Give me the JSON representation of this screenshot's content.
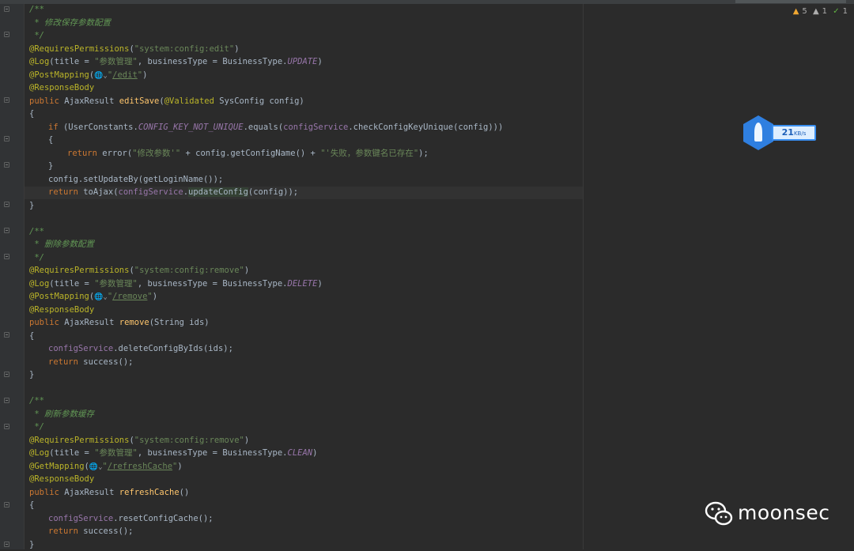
{
  "inspections": {
    "warnings": "5",
    "weak_warnings": "1",
    "ok": "1"
  },
  "net_widget": {
    "speed": "21",
    "unit": "KB/s"
  },
  "watermark": {
    "text": "moonsec"
  },
  "code": {
    "b1": {
      "doc_open": "/**",
      "doc_text": " * 修改保存参数配置",
      "doc_close": " */",
      "perm_ann": "@RequiresPermissions",
      "perm_val": "\"system:config:edit\"",
      "log_ann": "@Log",
      "log_args_a": "(title = ",
      "log_title": "\"参数管理\"",
      "log_args_b": ", businessType = BusinessType.",
      "log_type": "UPDATE",
      "map_ann": "@PostMapping",
      "map_path": "/edit",
      "resp_ann": "@ResponseBody",
      "sig_kw": "public",
      "sig_type": " AjaxResult ",
      "sig_name": "editSave",
      "sig_valid": "@Validated",
      "sig_params": " SysConfig config)",
      "brace_open": "{",
      "if_kw": "if",
      "if_a": " (UserConstants.",
      "if_const": "CONFIG_KEY_NOT_UNIQUE",
      "if_b": ".equals(",
      "if_field": "configService",
      "if_c": ".checkConfigKeyUnique(config)))",
      "inner_open": "{",
      "ret_kw": "return",
      "ret_a": " error(",
      "ret_s1": "\"修改参数'\"",
      "ret_b": " + config.getConfigName() + ",
      "ret_s2": "\"'失败，参数键名已存在\"",
      "ret_c": ");",
      "inner_close": "}",
      "setup": "config.setUpdateBy(getLoginName());",
      "ret2_kw": "return",
      "ret2_a": " toAjax(",
      "ret2_field": "configService",
      "ret2_dot": ".",
      "ret2_call": "updateConfig",
      "ret2_b": "(config));",
      "brace_close": "}"
    },
    "b2": {
      "doc_open": "/**",
      "doc_text": " * 删除参数配置",
      "doc_close": " */",
      "perm_ann": "@RequiresPermissions",
      "perm_val": "\"system:config:remove\"",
      "log_ann": "@Log",
      "log_args_a": "(title = ",
      "log_title": "\"参数管理\"",
      "log_args_b": ", businessType = BusinessType.",
      "log_type": "DELETE",
      "map_ann": "@PostMapping",
      "map_path": "/remove",
      "resp_ann": "@ResponseBody",
      "sig_kw": "public",
      "sig_type": " AjaxResult ",
      "sig_name": "remove",
      "sig_params": "(String ids)",
      "brace_open": "{",
      "s1_field": "configService",
      "s1_rest": ".deleteConfigByIds(ids);",
      "ret_kw": "return",
      "ret_rest": " success();",
      "brace_close": "}"
    },
    "b3": {
      "doc_open": "/**",
      "doc_text": " * 刷新参数缓存",
      "doc_close": " */",
      "perm_ann": "@RequiresPermissions",
      "perm_val": "\"system:config:remove\"",
      "log_ann": "@Log",
      "log_args_a": "(title = ",
      "log_title": "\"参数管理\"",
      "log_args_b": ", businessType = BusinessType.",
      "log_type": "CLEAN",
      "map_ann": "@GetMapping",
      "map_path": "/refreshCache",
      "resp_ann": "@ResponseBody",
      "sig_kw": "public",
      "sig_type": " AjaxResult ",
      "sig_name": "refreshCache",
      "sig_params": "()",
      "brace_open": "{",
      "s1_field": "configService",
      "s1_rest": ".resetConfigCache();",
      "ret_kw": "return",
      "ret_rest": " success();",
      "brace_close": "}"
    }
  }
}
